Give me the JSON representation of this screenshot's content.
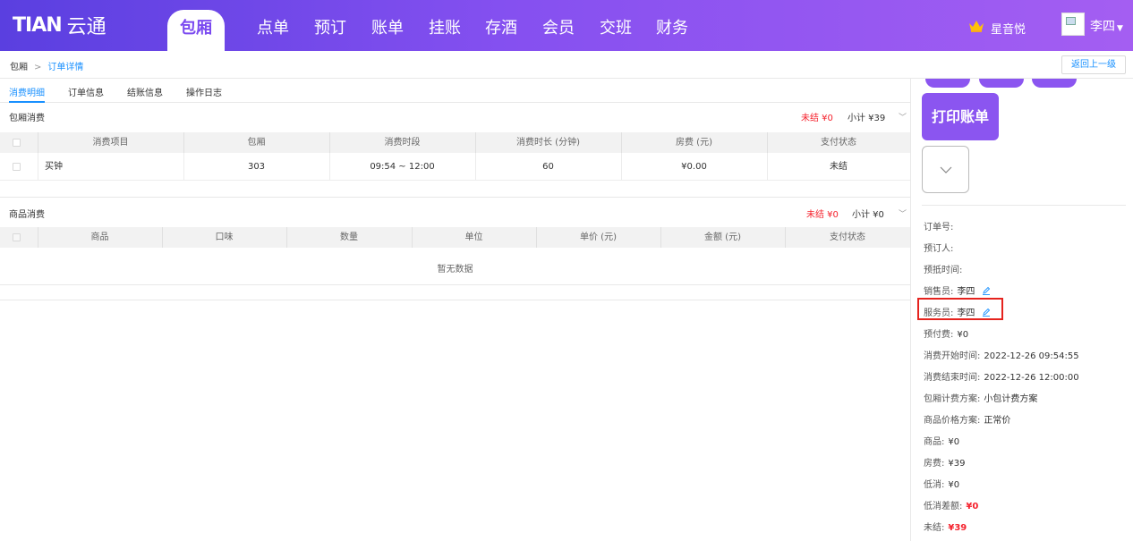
{
  "header": {
    "logo_mark": "TIAN",
    "logo_text": "云通",
    "nav": [
      "包厢",
      "点单",
      "预订",
      "账单",
      "挂账",
      "存酒",
      "会员",
      "交班",
      "财务"
    ],
    "active_nav": "包厢",
    "store_name": "星音悦",
    "user_name": "李四",
    "brand_gradient": [
      "#5a3fe0",
      "#a45ef2"
    ]
  },
  "breadcrumb": {
    "root": "包厢",
    "current": "订单详情",
    "back_label": "返回上一级"
  },
  "tabs": [
    "消费明细",
    "订单信息",
    "结账信息",
    "操作日志"
  ],
  "room_section": {
    "title": "包厢消费",
    "unpaid": "未结 ¥0",
    "subtotal": "小计 ¥39",
    "columns": [
      "消费项目",
      "包厢",
      "消费时段",
      "消费时长 (分钟)",
      "房费 (元)",
      "支付状态"
    ],
    "rows": [
      {
        "item": "买钟",
        "room": "303",
        "period": "09:54 ~ 12:00",
        "minutes": "60",
        "fee": "¥0.00",
        "status": "未结"
      }
    ]
  },
  "goods_section": {
    "title": "商品消费",
    "unpaid": "未结 ¥0",
    "subtotal": "小计 ¥0",
    "columns": [
      "商品",
      "口味",
      "数量",
      "单位",
      "单价 (元)",
      "金额 (元)",
      "支付状态"
    ],
    "empty_text": "暂无数据"
  },
  "side_panel": {
    "print_label": "打印账单",
    "info": {
      "order_no_label": "订单号:",
      "booker_label": "预订人:",
      "arrival_label": "预抵时间:",
      "sales_label": "销售员:",
      "sales_value": "李四",
      "waiter_label": "服务员:",
      "waiter_value": "李四",
      "prepaid_label": "预付费:",
      "prepaid_value": "¥0",
      "start_label": "消费开始时间:",
      "start_value": "2022-12-26 09:54:55",
      "end_label": "消费结束时间:",
      "end_value": "2022-12-26 12:00:00",
      "room_plan_label": "包厢计费方案:",
      "room_plan_value": "小包计费方案",
      "price_plan_label": "商品价格方案:",
      "price_plan_value": "正常价",
      "goods_label": "商品:",
      "goods_value": "¥0",
      "room_fee_label": "房费:",
      "room_fee_value": "¥39",
      "min_label": "低消:",
      "min_value": "¥0",
      "min_diff_label": "低消差额:",
      "min_diff_value": "¥0",
      "unpaid_label": "未结:",
      "unpaid_value": "¥39"
    }
  }
}
